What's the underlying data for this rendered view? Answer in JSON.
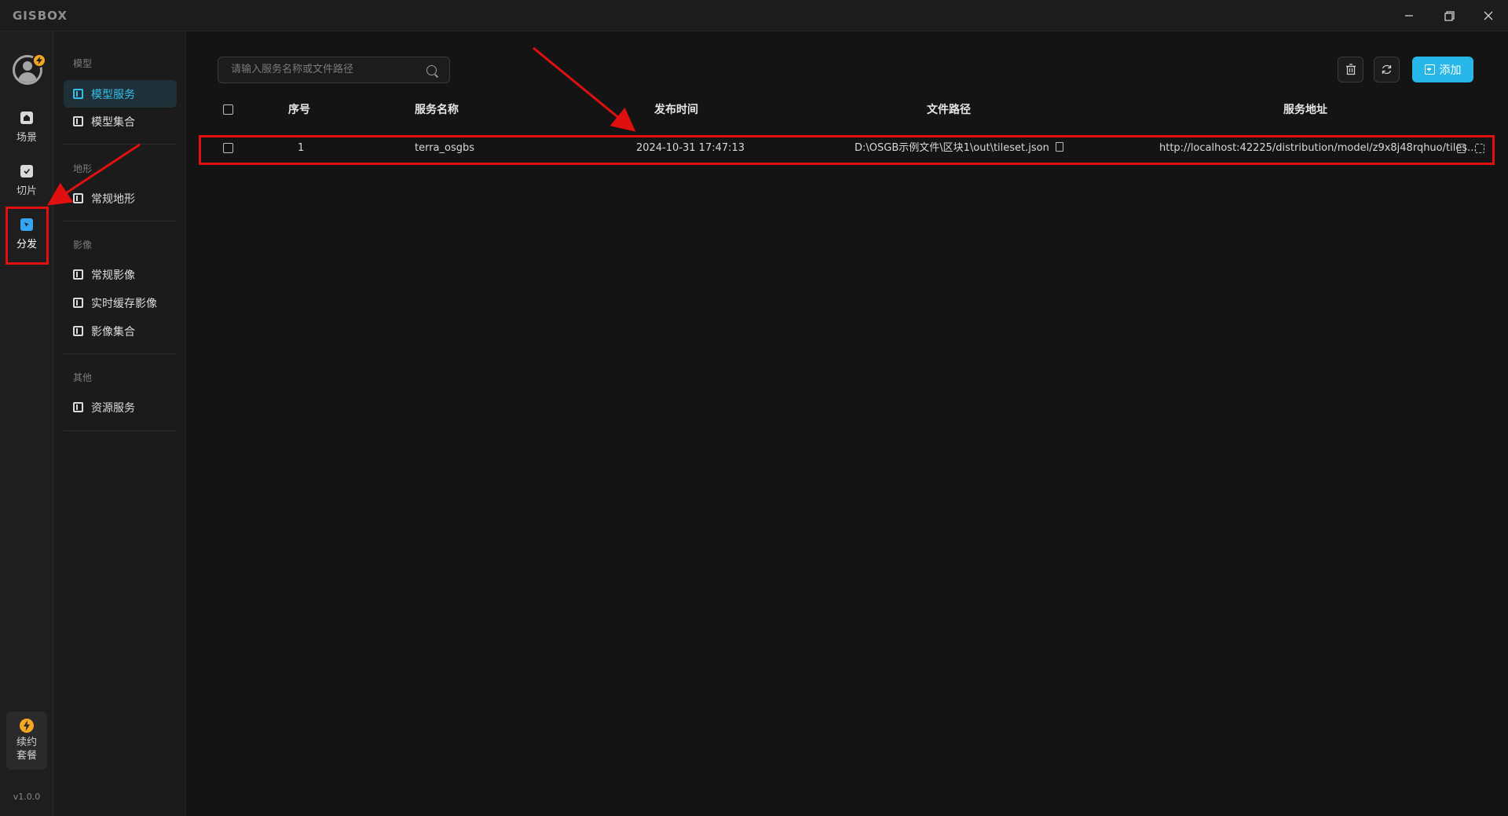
{
  "app": {
    "logo": "GISBOX",
    "version": "v1.0.0"
  },
  "window_controls": {
    "minimize": "minimize",
    "restore": "restore",
    "close": "close"
  },
  "rail": {
    "items": [
      {
        "label": "场景",
        "icon": "home-icon"
      },
      {
        "label": "切片",
        "icon": "slice-icon"
      },
      {
        "label": "分发",
        "icon": "distribute-icon",
        "active": true
      }
    ],
    "renew_label": "续约套餐"
  },
  "subnav": {
    "groups": [
      {
        "title": "模型",
        "items": [
          {
            "label": "模型服务",
            "active": true
          },
          {
            "label": "模型集合"
          }
        ]
      },
      {
        "title": "地形",
        "items": [
          {
            "label": "常规地形"
          }
        ]
      },
      {
        "title": "影像",
        "items": [
          {
            "label": "常规影像"
          },
          {
            "label": "实时缓存影像"
          },
          {
            "label": "影像集合"
          }
        ]
      },
      {
        "title": "其他",
        "items": [
          {
            "label": "资源服务"
          }
        ]
      }
    ]
  },
  "toolbar": {
    "search_placeholder": "请输入服务名称或文件路径",
    "add_label": "添加"
  },
  "table": {
    "headers": [
      "序号",
      "服务名称",
      "发布时间",
      "文件路径",
      "服务地址"
    ],
    "rows": [
      {
        "index": "1",
        "name": "terra_osgbs",
        "time": "2024-10-31 17:47:13",
        "path": "D:\\OSGB示例文件\\区块1\\out\\tileset.json",
        "url": "http://localhost:42225/distribution/model/z9x8j48rqhuo/tiles..."
      }
    ]
  },
  "colors": {
    "accent": "#26b7e8",
    "annotation": "#e01010",
    "badge": "#f5a623"
  }
}
